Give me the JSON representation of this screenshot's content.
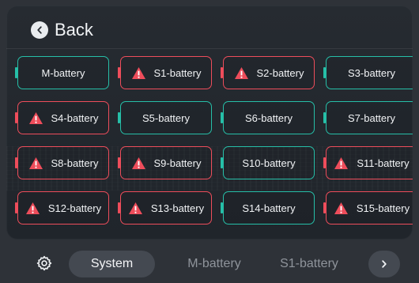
{
  "header": {
    "back_label": "Back"
  },
  "batteries": [
    {
      "label": "M-battery",
      "warning": false
    },
    {
      "label": "S1-battery",
      "warning": true
    },
    {
      "label": "S2-battery",
      "warning": true
    },
    {
      "label": "S3-battery",
      "warning": false
    },
    {
      "label": "S4-battery",
      "warning": true
    },
    {
      "label": "S5-battery",
      "warning": false
    },
    {
      "label": "S6-battery",
      "warning": false
    },
    {
      "label": "S7-battery",
      "warning": false
    },
    {
      "label": "S8-battery",
      "warning": true
    },
    {
      "label": "S9-battery",
      "warning": true
    },
    {
      "label": "S10-battery",
      "warning": false
    },
    {
      "label": "S11-battery",
      "warning": true
    },
    {
      "label": "S12-battery",
      "warning": true
    },
    {
      "label": "S13-battery",
      "warning": true
    },
    {
      "label": "S14-battery",
      "warning": false
    },
    {
      "label": "S15-battery",
      "warning": true
    }
  ],
  "bottom_nav": {
    "tabs": [
      {
        "label": "System"
      },
      {
        "label": "M-battery"
      },
      {
        "label": "S1-battery"
      }
    ]
  },
  "icons": {
    "settings": "settings-icon",
    "back": "chevron-left-icon",
    "next": "chevron-right-icon",
    "warning": "warning-triangle-icon"
  },
  "colors": {
    "normal_border": "#26bfa8",
    "warning_border": "#ee4d5b",
    "text": "#f1f3f5",
    "inactive_text": "#8f949b"
  }
}
